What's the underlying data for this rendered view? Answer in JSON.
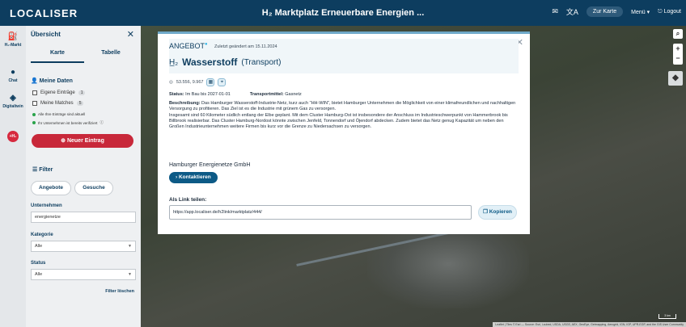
{
  "app": {
    "logo": "LOCALISER",
    "title": "H₂ Marktplatz Erneuerbare Energien ...",
    "actions": {
      "view_toggle": "Zur Karte",
      "menu": "Menü ▾",
      "logout": "Logout",
      "mail_icon": "mail-icon",
      "translate_icon": "translate-icon",
      "logout_icon": "logout-icon"
    }
  },
  "rail": {
    "items": [
      {
        "label": "H₂-Markt",
        "icon": "tank-icon"
      },
      {
        "label": "Chat",
        "icon": "chat-icon"
      },
      {
        "label": "Digitaltwin",
        "icon": "layers-icon"
      }
    ],
    "h2_badge": "+H₂"
  },
  "panel": {
    "title": "Übersicht",
    "tabs": [
      "Karte",
      "Tabelle"
    ],
    "my_data": {
      "title": "Meine Daten",
      "own_entries": {
        "label": "Eigene Einträge",
        "count": "1"
      },
      "my_matches": {
        "label": "Meine Matches",
        "count": "5"
      },
      "note_1": "Alle Ihre Einträge sind aktuell",
      "note_2": "Ihr Unternehmen ist bereits verifiziert"
    },
    "new_entry": "Neuer Eintrag",
    "filter": {
      "title": "Filter",
      "segments": [
        "Angebote",
        "Gesuche"
      ],
      "company_label": "Unternehmen",
      "company_value": "energienetze",
      "category_label": "Kategorie",
      "category_value": "Alle",
      "status_label": "Status",
      "status_value": "Alle",
      "reset": "Filter löschen"
    }
  },
  "map": {
    "zoom_in": "+",
    "zoom_out": "−",
    "scale": "3 km",
    "attribution": "Leaflet | Tiles © Esri — Source: Esri, i-cubed, USDA, USGS, AEX, GeoEye, Getmapping, Aerogrid, IGN, IGP, UPR-EGP, and the GIS User Community"
  },
  "modal": {
    "badge": "ANGEBOT",
    "updated": "Zuletzt geändert am 15.11.2024",
    "title": "Wasserstoff",
    "subtitle": "(Transport)",
    "coords": "53.556, 9.967",
    "status_label": "Status:",
    "status_value": "Im Bau bis 2027-01-01",
    "transport_label": "Transportmittel:",
    "transport_value": "Gasnetz",
    "desc_label": "Beschreibung:",
    "desc_p1": "Das Hamburger Wasserstoff-Industrie-Netz, kurz auch \"HH-WIN\", bietet Hamburger Unternehmen die Möglichkeit von einer klimafreundlichen und nachhaltigen Versorgung zu profitieren. Das Ziel ist es die Industrie mit grünem Gas zu versorgen.",
    "desc_p2": "Insgesamt sind 60 Kilometer südlich entlang der Elbe geplant. Mit dem Cluster Hamburg-Ost ist insbesondere der Anschluss im Industrieschwerpunkt von Hammerbrook bis Billbrook realisierbar. Das Cluster Hamburg-Nordost könnte zwischen Jenfeld, Tonnendorf und Öjendorf abdecken. Zudem bietet das Netz genug Kapazität um neben den Großen Industrieunternehmen weitere Firmen bis kurz vor die Grenze zu Niedersachsen zu versorgen.",
    "company": "Hamburger Energienetze GmbH",
    "contact": "Kontaktieren",
    "link_label": "Als Link teilen:",
    "link_value": "https://app.localiser.de/h2link/marktplatz/444/",
    "copy": "Kopieren"
  }
}
